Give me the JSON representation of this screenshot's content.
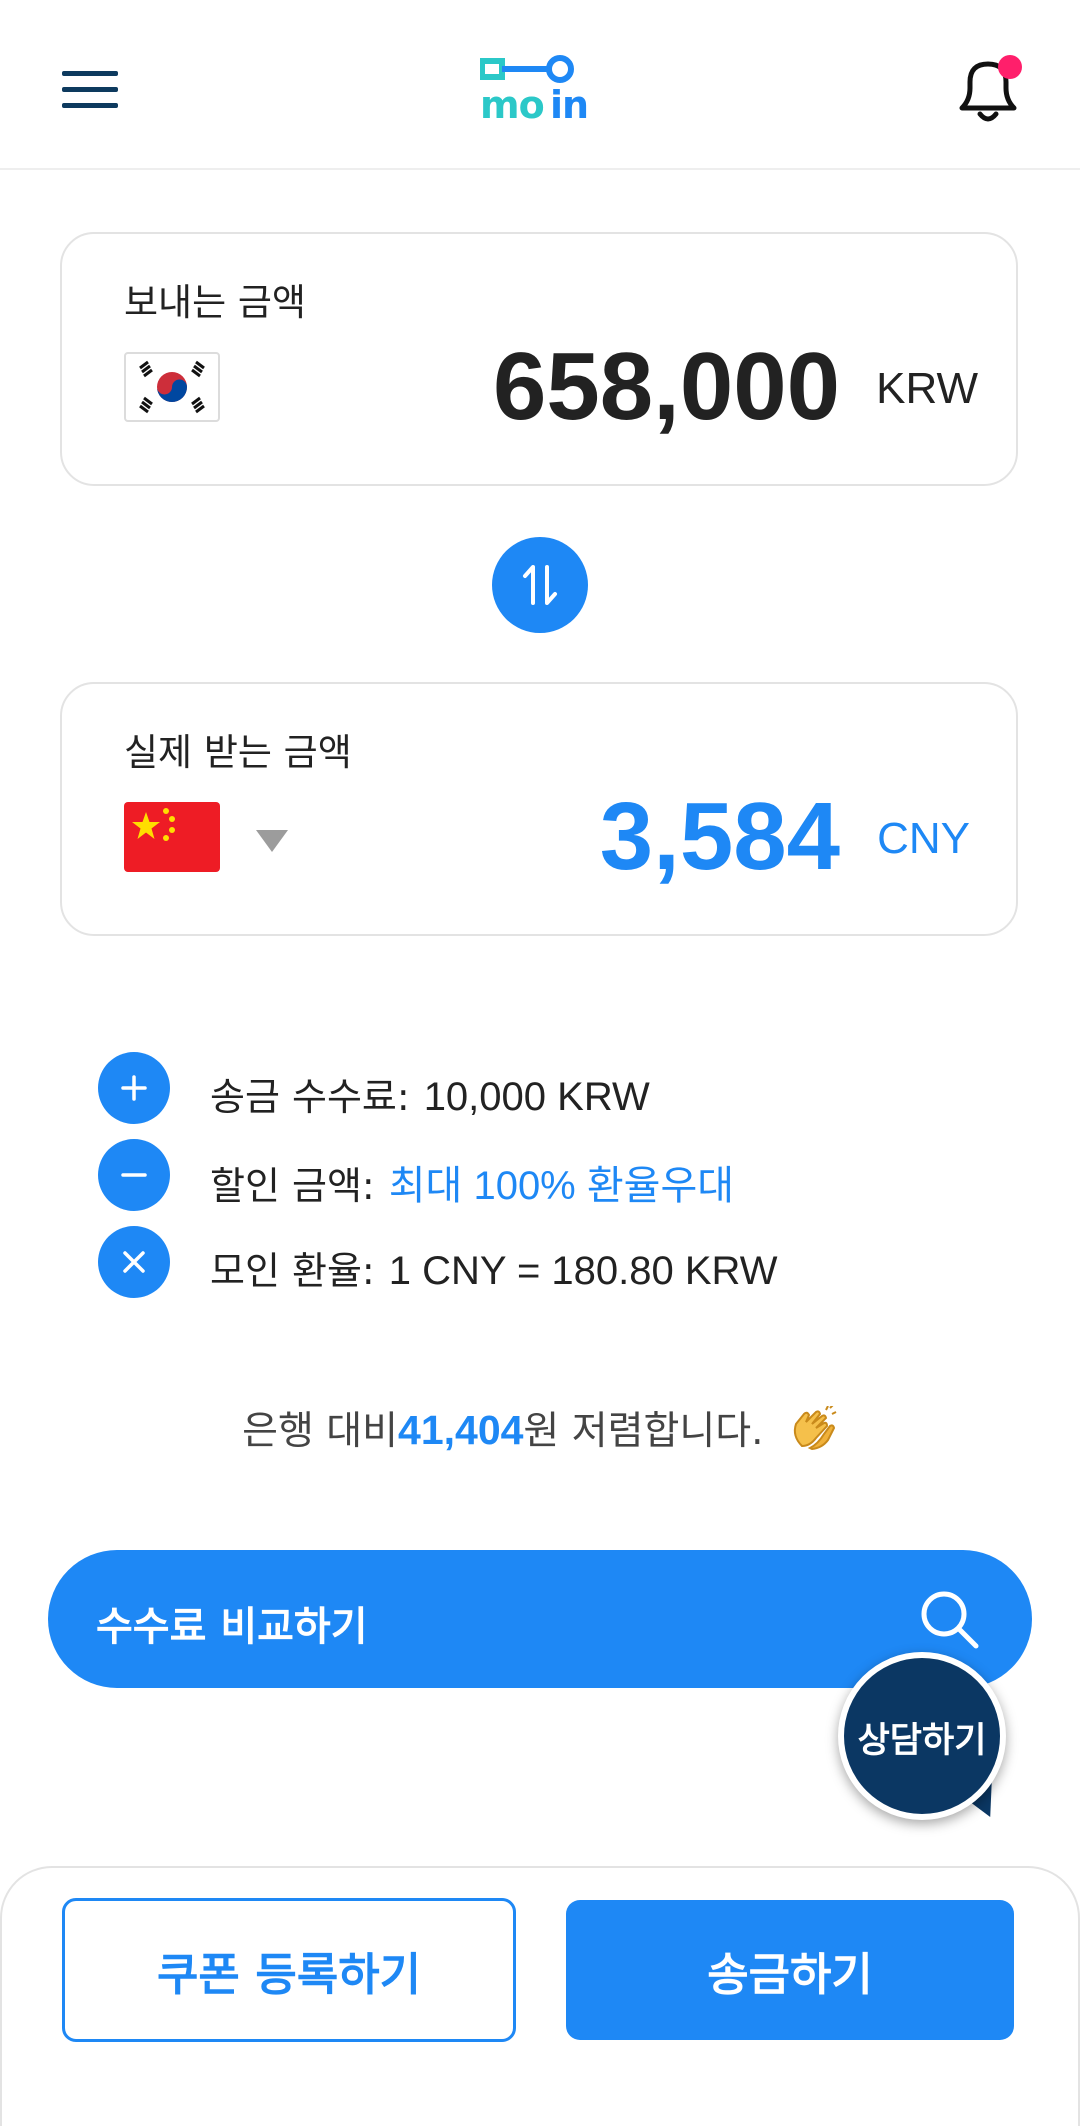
{
  "header": {
    "menu_icon": "hamburger-menu-icon",
    "logo_text": "moin",
    "bell_icon": "bell-icon",
    "notification_dot_color": "#ff1f6b"
  },
  "send": {
    "label": "보내는 금액",
    "amount": "658,000",
    "currency": "KRW",
    "flag": "south-korea-flag"
  },
  "swap_icon": "swap-arrows-icon",
  "receive": {
    "label": "실제 받는 금액",
    "amount": "3,584",
    "currency": "CNY",
    "flag": "china-flag",
    "dropdown_icon": "caret-down-icon"
  },
  "fees": [
    {
      "icon": "plus-icon",
      "label": "송금 수수료:",
      "value": "10,000 KRW"
    },
    {
      "icon": "minus-icon",
      "label": "할인 금액:",
      "value": "최대 100% 환율우대"
    },
    {
      "icon": "times-icon",
      "label": "모인 환율:",
      "value": "1 CNY = 180.80 KRW"
    }
  ],
  "savings": {
    "prefix": "은행 대비",
    "amount": "41,404",
    "suffix": "원 저렴합니다.",
    "icon": "clapping-hands-icon"
  },
  "compare_button": {
    "label": "수수료 비교하기",
    "icon": "search-icon"
  },
  "chat_button": {
    "label": "상담하기"
  },
  "bottom": {
    "coupon_label": "쿠폰 등록하기",
    "send_label": "송금하기"
  },
  "colors": {
    "accent": "#1e88f5",
    "navy": "#0b3763",
    "logo_teal": "#2bc8c8",
    "logo_blue": "#1e88f5"
  }
}
